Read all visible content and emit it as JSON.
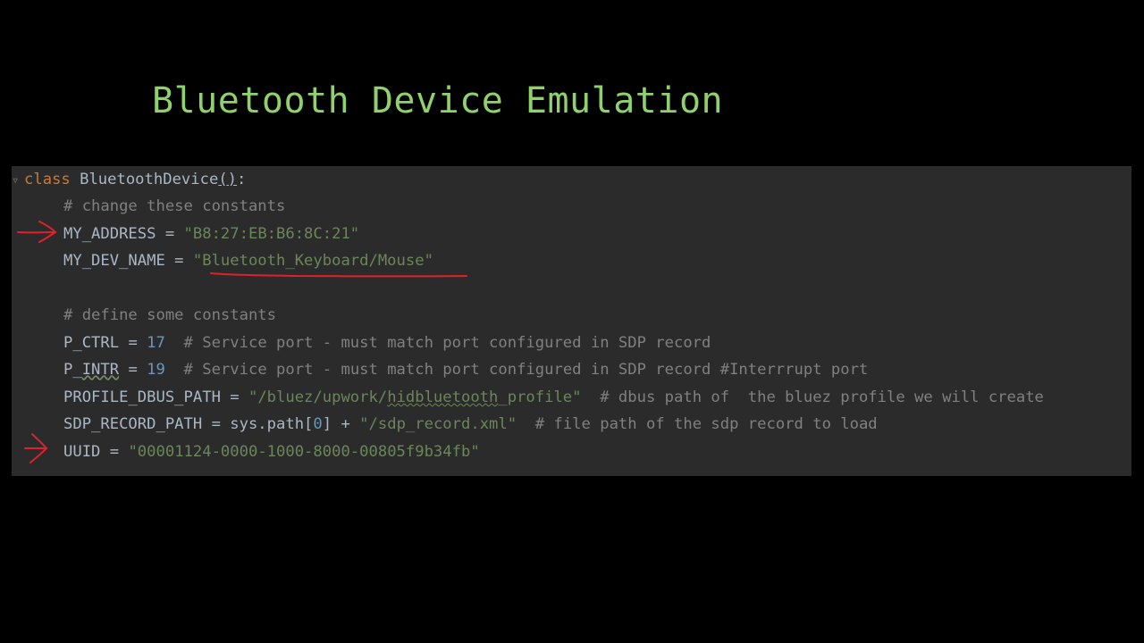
{
  "slide": {
    "title": "Bluetooth Device Emulation"
  },
  "code": {
    "line1": {
      "kw": "class",
      "name": " BluetoothDevice",
      "paren": "()",
      "colon": ":"
    },
    "line2": {
      "comment": "# change these constants"
    },
    "line3": {
      "ident": "MY_ADDRESS",
      "op": " = ",
      "str": "\"B8:27:EB:B6:8C:21\""
    },
    "line4": {
      "ident": "MY_DEV_NAME",
      "op": " = ",
      "str": "\"Bluetooth_Keyboard/Mouse\""
    },
    "line6": {
      "comment": "# define some constants"
    },
    "line7": {
      "ident": "P_CTRL",
      "op": " = ",
      "num": "17",
      "comment": "  # Service port - must match port configured in SDP record"
    },
    "line8": {
      "ident_a": "P_",
      "ident_b": "INTR",
      "op": " = ",
      "num": "19",
      "comment": "  # Service port - must match port configured in SDP record #Interrrupt port"
    },
    "line9": {
      "ident": "PROFILE_DBUS_PATH",
      "op": " = ",
      "str_a": "\"/bluez/upwork/",
      "str_b": "hidbluetooth",
      "str_c": "_profile\"",
      "comment": "  # dbus path of  the bluez profile we will create"
    },
    "line10": {
      "ident": "SDP_RECORD_PATH",
      "op": " = sys.path[",
      "num": "0",
      "op2": "] + ",
      "str": "\"/sdp_record.xml\"",
      "comment": "  # file path of the sdp record to load"
    },
    "line11": {
      "ident": "UUID",
      "op": " = ",
      "str": "\"00001124-0000-1000-8000-00805f9b34fb\""
    }
  },
  "colors": {
    "title": "#8fd16a",
    "editor_bg": "#2b2b2b",
    "keyword": "#cc7832",
    "string": "#6a8759",
    "number": "#6897bb",
    "comment": "#808080",
    "annotation": "#e0202a"
  }
}
